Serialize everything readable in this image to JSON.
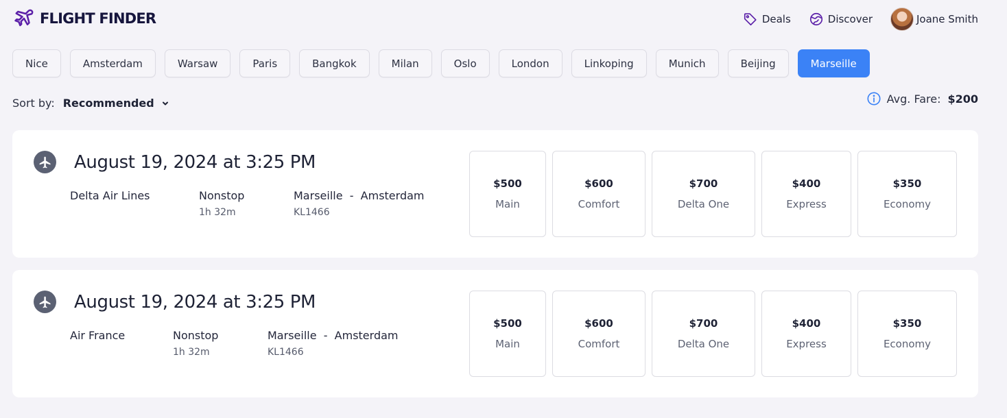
{
  "app": {
    "logo_text": "FLIGHT FINDER",
    "brand_color": "#5b1fa8",
    "accent_color": "#3b82f6"
  },
  "nav": {
    "deals": "Deals",
    "discover": "Discover",
    "user_name": "Joane Smith"
  },
  "cities": [
    "Nice",
    "Amsterdam",
    "Warsaw",
    "Paris",
    "Bangkok",
    "Milan",
    "Oslo",
    "London",
    "Linkoping",
    "Munich",
    "Beijing",
    "Marseille"
  ],
  "active_city": "Marseille",
  "sort": {
    "label": "Sort by:",
    "value": "Recommended"
  },
  "avg_fare": {
    "label": "Avg. Fare:",
    "value": "$200"
  },
  "flights": [
    {
      "date": "August 19, 2024 at 3:25 PM",
      "airline": "Delta Air Lines",
      "stops": "Nonstop",
      "duration": "1h 32m",
      "route": "Marseille  -  Amsterdam",
      "flight_no": "KL1466",
      "fares": [
        {
          "price": "$500",
          "class": "Main"
        },
        {
          "price": "$600",
          "class": "Comfort"
        },
        {
          "price": "$700",
          "class": "Delta One"
        },
        {
          "price": "$400",
          "class": "Express"
        },
        {
          "price": "$350",
          "class": "Economy"
        }
      ]
    },
    {
      "date": "August 19, 2024 at 3:25 PM",
      "airline": "Air France",
      "stops": "Nonstop",
      "duration": "1h 32m",
      "route": "Marseille  -  Amsterdam",
      "flight_no": "KL1466",
      "fares": [
        {
          "price": "$500",
          "class": "Main"
        },
        {
          "price": "$600",
          "class": "Comfort"
        },
        {
          "price": "$700",
          "class": "Delta One"
        },
        {
          "price": "$400",
          "class": "Express"
        },
        {
          "price": "$350",
          "class": "Economy"
        }
      ]
    }
  ]
}
